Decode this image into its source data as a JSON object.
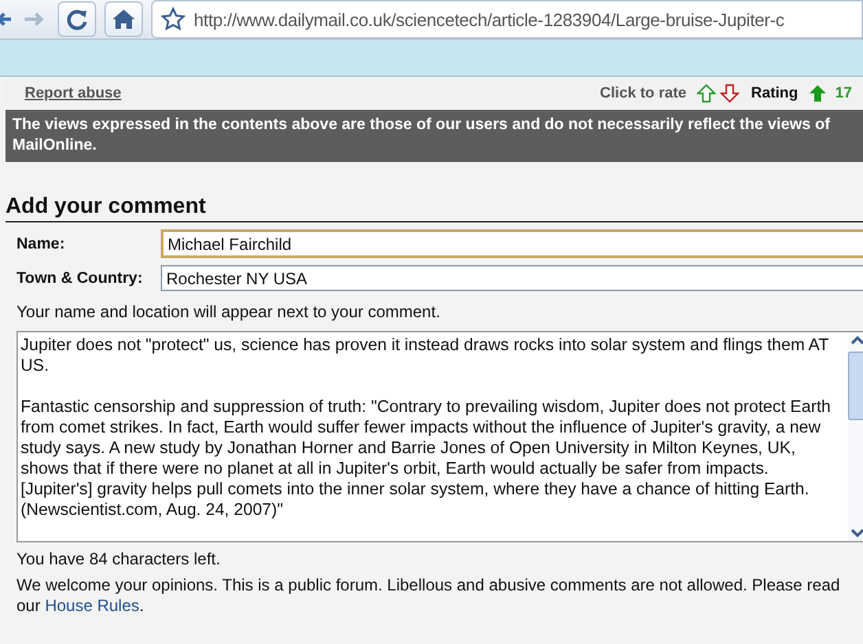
{
  "toolbar": {
    "url": "http://www.dailymail.co.uk/sciencetech/article-1283904/Large-bruise-Jupiter-c"
  },
  "comment_bar": {
    "report_link": "Report abuse",
    "rate_label": "Click to rate",
    "rating_label": "Rating",
    "rating_value": "17"
  },
  "disclaimer": "The views expressed in the contents above are those of our users and do not necessarily reflect the views of MailOnline.",
  "form": {
    "heading": "Add your comment",
    "fields": [
      {
        "label": "Name:",
        "value": "Michael Fairchild",
        "focused": true
      },
      {
        "label": "Town & Country:",
        "value": "Rochester NY USA",
        "focused": false
      }
    ],
    "note": "Your name and location will appear next to your comment.",
    "comment": "Jupiter does not \"protect\" us, science has proven it instead draws rocks into solar system and flings them AT US.\n\nFantastic censorship and suppression of truth: \"Contrary to prevailing wisdom, Jupiter does not protect Earth from comet strikes. In fact, Earth would suffer fewer impacts without the influence of Jupiter's gravity, a new study says. A new study by Jonathan Horner and Barrie Jones of Open University in Milton Keynes, UK, shows that if there were no planet at all in Jupiter's orbit, Earth would actually be safer from impacts. [Jupiter's] gravity helps pull comets into the inner solar system, where they have a chance of hitting Earth. (Newscientist.com, Aug. 24, 2007)\"",
    "chars_left": "You have 84 characters left.",
    "policy": "We welcome your opinions. This is a public forum. Libellous and abusive comments are not allowed. Please read our",
    "policy_link": "House Rules",
    "policy_end": "."
  }
}
